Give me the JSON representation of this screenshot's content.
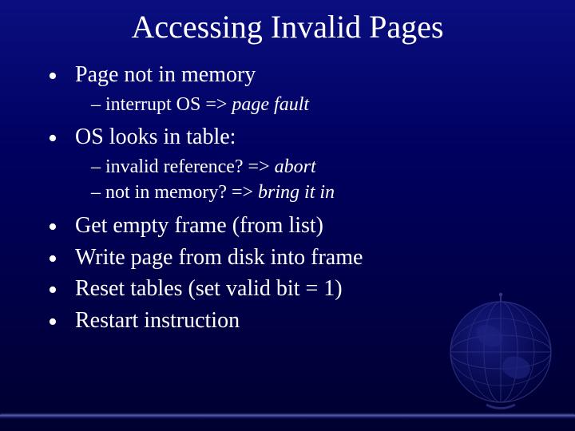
{
  "title": "Accessing Invalid Pages",
  "bullets": {
    "b0": {
      "text": "Page not in memory",
      "sub": {
        "s0": {
          "pre": "interrupt OS => ",
          "it": "page fault"
        }
      }
    },
    "b1": {
      "text": "OS looks in table:",
      "sub": {
        "s0": {
          "pre": "invalid reference? => ",
          "it": "abort"
        },
        "s1": {
          "pre": "not in memory? => ",
          "it": "bring it in"
        }
      }
    },
    "b2": {
      "text": "Get empty frame (from list)"
    },
    "b3": {
      "text": "Write page from disk into frame"
    },
    "b4": {
      "text": "Reset tables (set valid bit = 1)"
    },
    "b5": {
      "text": "Restart instruction"
    }
  }
}
